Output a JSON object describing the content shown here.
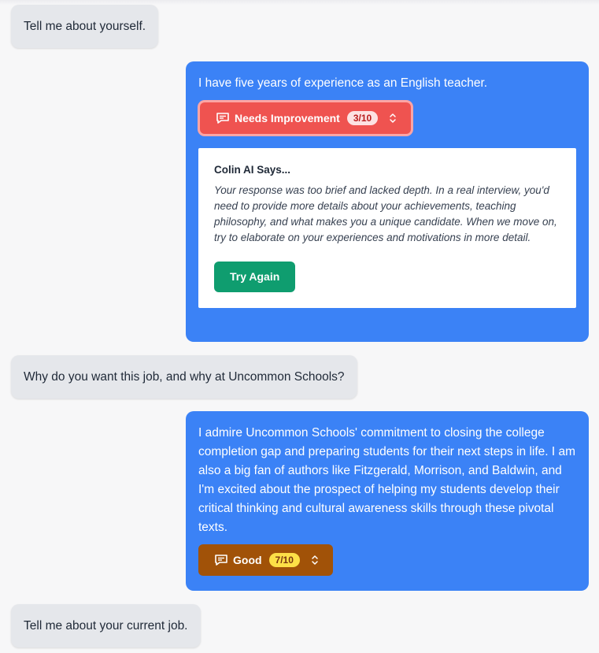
{
  "conversation": {
    "q1": "Tell me about yourself.",
    "a1": {
      "text": "I have five years of experience as an English teacher.",
      "rating_label": "Needs Improvement",
      "rating_score": "3/10",
      "rating_color": "#ef5350",
      "feedback": {
        "title": "Colin AI Says...",
        "body": "Your response was too brief and lacked depth. In a real interview, you'd need to provide more details about your achievements, teaching philosophy, and what makes you a unique candidate. When we move on, try to elaborate on your experiences and motivations in more detail.",
        "try_again_label": "Try Again",
        "button_color": "#0f9d6f"
      }
    },
    "q2": "Why do you want this job, and why at Uncommon Schools?",
    "a2": {
      "text": "I admire Uncommon Schools' commitment to closing the college completion gap and preparing students for their next steps in life. I am also a big fan of authors like Fitzgerald, Morrison, and Baldwin, and I'm excited about the prospect of helping my students develop their critical thinking and cultural awareness skills through these pivotal texts.",
      "rating_label": "Good",
      "rating_score": "7/10",
      "rating_color": "#a15208"
    },
    "q3": "Tell me about your current job."
  },
  "icons": {
    "rating": "chat-bubble-icon",
    "expand": "chevron-up-down-icon"
  },
  "colors": {
    "answer_bubble": "#3b82f6",
    "question_bubble": "#e5e7eb"
  }
}
